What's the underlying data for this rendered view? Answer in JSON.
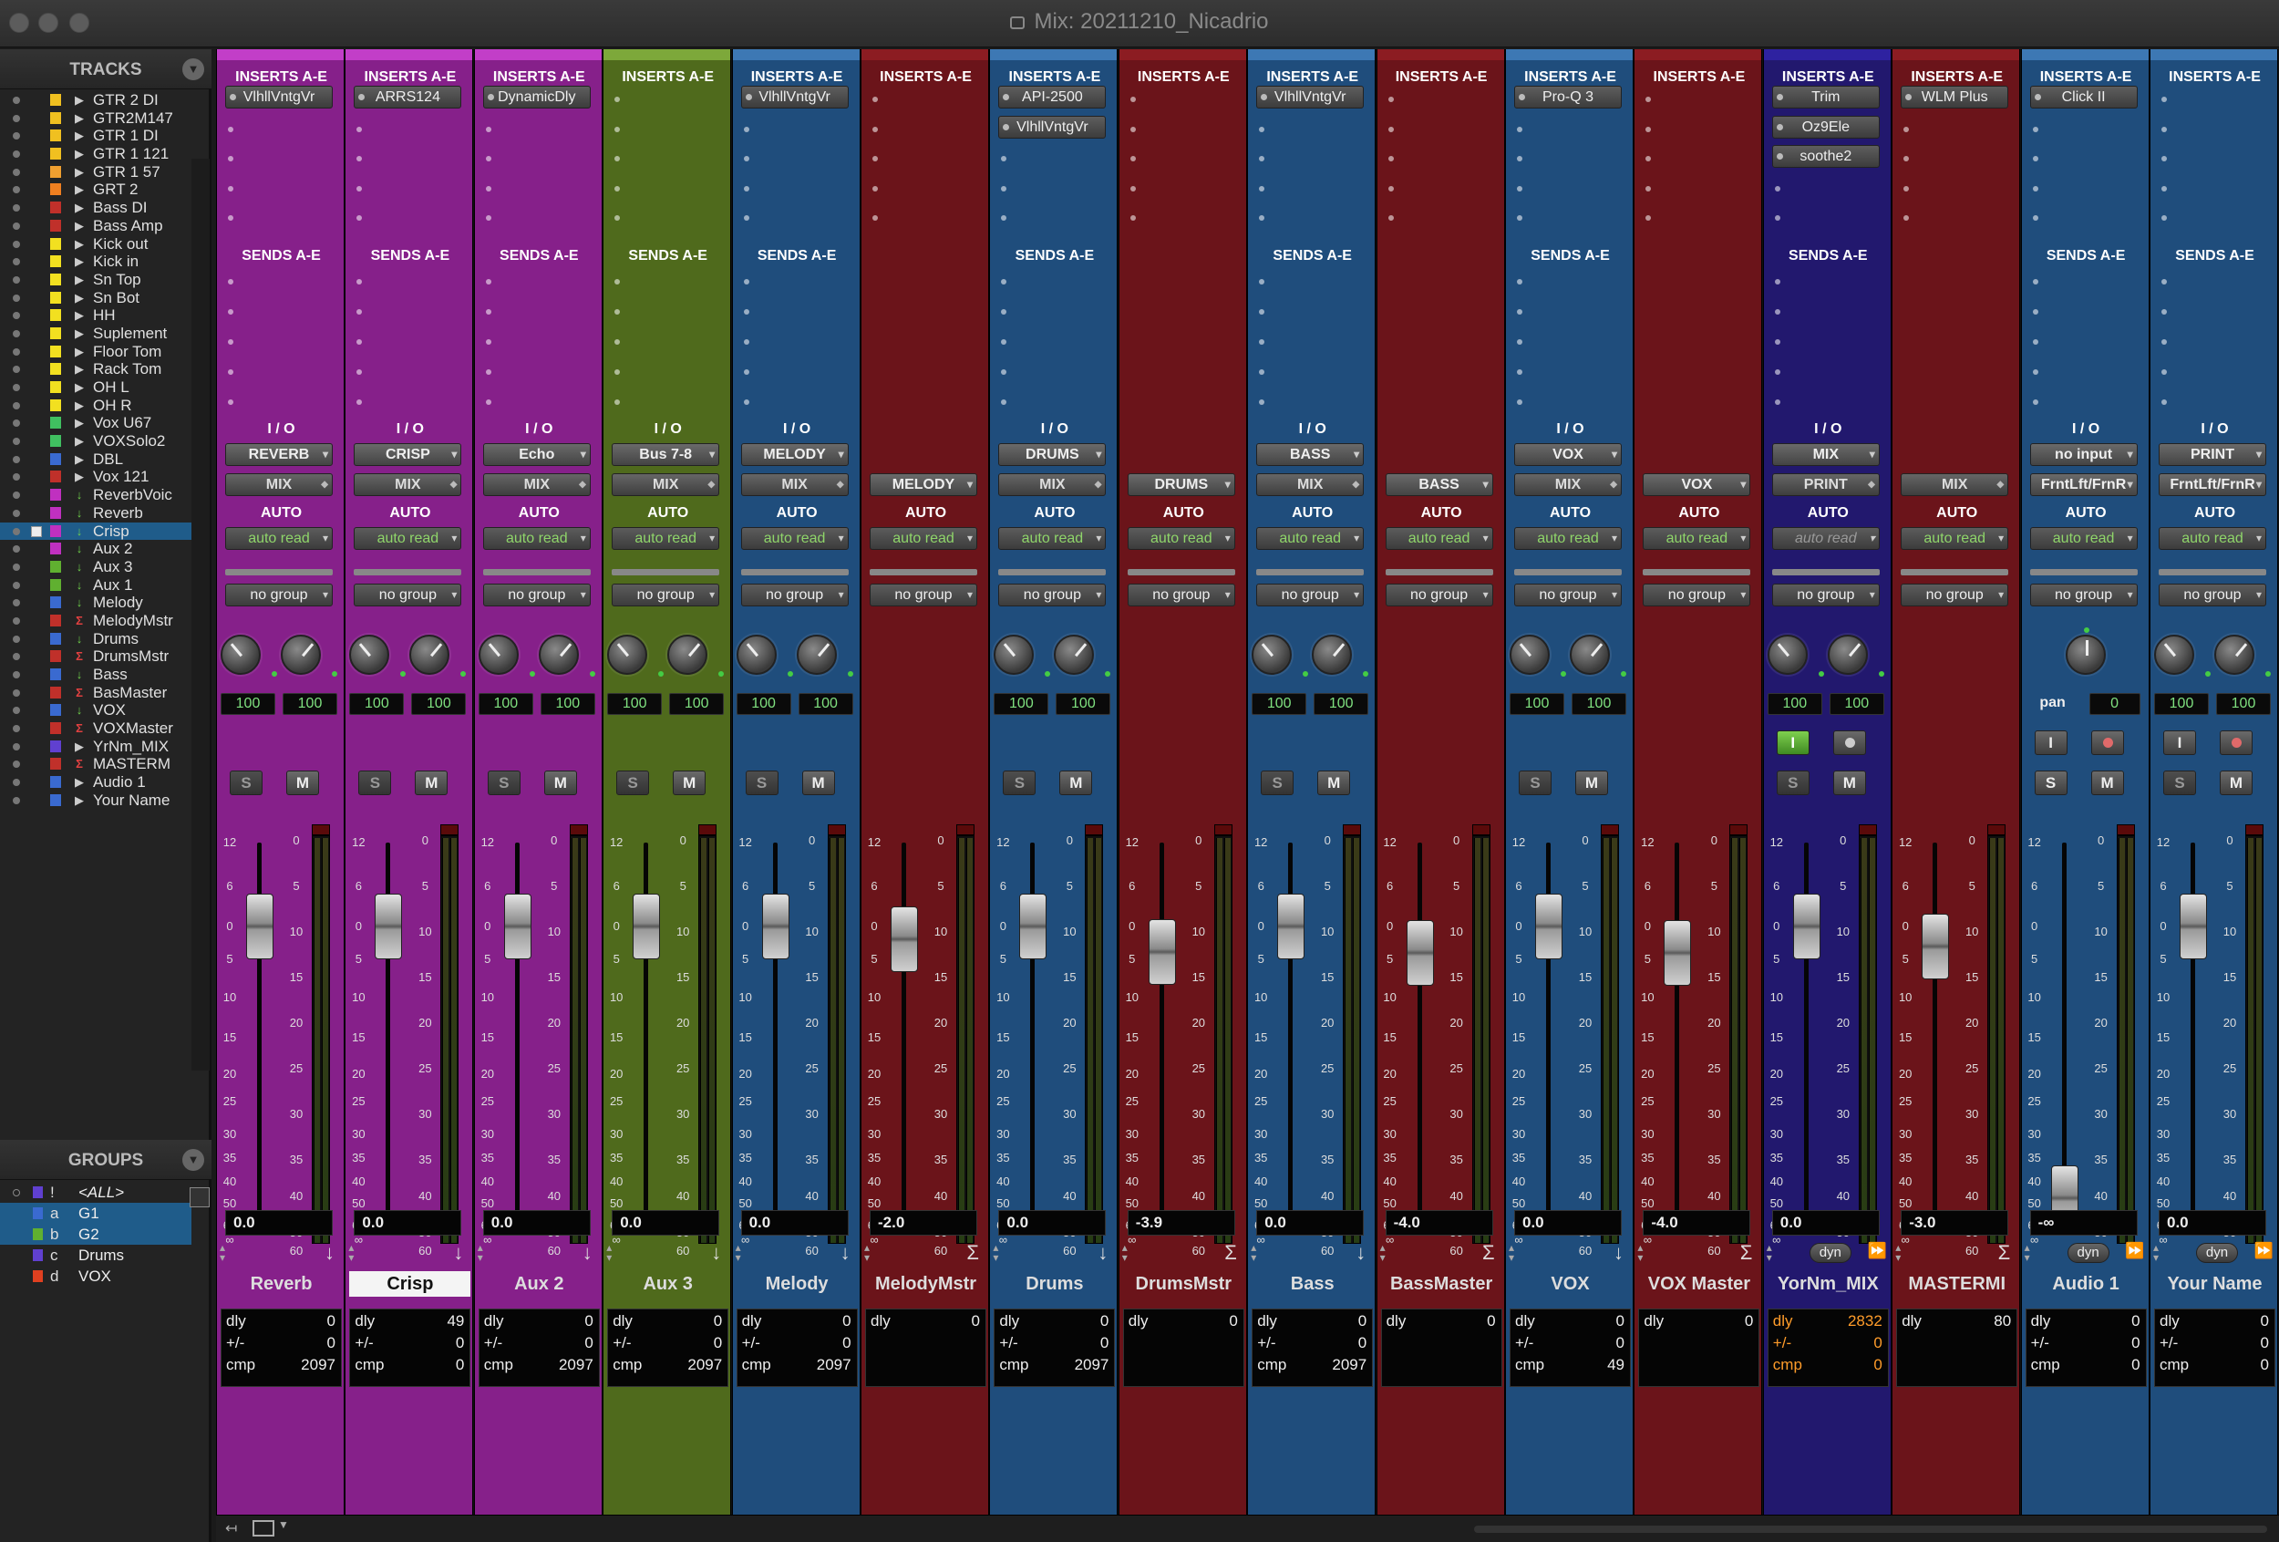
{
  "window": {
    "title": "Mix: 20211210_Nicadrio"
  },
  "tracks_panel": {
    "title": "TRACKS",
    "menu_icon": "chevron-down-icon"
  },
  "groups_panel": {
    "title": "GROUPS",
    "menu_icon": "chevron-down-icon"
  },
  "tracks": [
    {
      "name": "GTR 2 DI",
      "color": "#f0c020",
      "type": "audio"
    },
    {
      "name": "GTR2M147",
      "color": "#f0c020",
      "type": "audio"
    },
    {
      "name": "GTR 1 DI",
      "color": "#f0c020",
      "type": "audio"
    },
    {
      "name": "GTR 1 121",
      "color": "#f0c020",
      "type": "audio"
    },
    {
      "name": "GTR 1 57",
      "color": "#f0a030",
      "type": "audio"
    },
    {
      "name": "GRT 2",
      "color": "#f08020",
      "type": "audio"
    },
    {
      "name": "Bass DI",
      "color": "#c0302a",
      "type": "audio"
    },
    {
      "name": "Bass Amp",
      "color": "#c0302a",
      "type": "audio"
    },
    {
      "name": "Kick out",
      "color": "#f2e020",
      "type": "audio"
    },
    {
      "name": "Kick in",
      "color": "#f2e020",
      "type": "audio"
    },
    {
      "name": "Sn Top",
      "color": "#f2e020",
      "type": "audio"
    },
    {
      "name": "Sn Bot",
      "color": "#f2e020",
      "type": "audio"
    },
    {
      "name": "HH",
      "color": "#f2e020",
      "type": "audio"
    },
    {
      "name": "Suplement",
      "color": "#f2e020",
      "type": "audio"
    },
    {
      "name": "Floor Tom",
      "color": "#f2e020",
      "type": "audio"
    },
    {
      "name": "Rack Tom",
      "color": "#f2e020",
      "type": "audio"
    },
    {
      "name": "OH L",
      "color": "#f2e020",
      "type": "audio"
    },
    {
      "name": "OH R",
      "color": "#f2e020",
      "type": "audio"
    },
    {
      "name": "Vox U67",
      "color": "#40c060",
      "type": "audio"
    },
    {
      "name": "VOXSolo2",
      "color": "#40c060",
      "type": "audio"
    },
    {
      "name": "DBL",
      "color": "#3a6ad0",
      "type": "audio"
    },
    {
      "name": "Vox 121",
      "color": "#c0302a",
      "type": "audio"
    },
    {
      "name": "ReverbVoic",
      "color": "#c030c0",
      "type": "aux"
    },
    {
      "name": "Reverb",
      "color": "#c030c0",
      "type": "aux"
    },
    {
      "name": "Crisp",
      "color": "#c030c0",
      "type": "aux",
      "selected": true
    },
    {
      "name": "Aux 2",
      "color": "#c030c0",
      "type": "aux"
    },
    {
      "name": "Aux 3",
      "color": "#60b030",
      "type": "aux"
    },
    {
      "name": "Aux 1",
      "color": "#60b030",
      "type": "aux"
    },
    {
      "name": "Melody",
      "color": "#3a6ad0",
      "type": "aux"
    },
    {
      "name": "MelodyMstr",
      "color": "#c0302a",
      "type": "vca"
    },
    {
      "name": "Drums",
      "color": "#3a6ad0",
      "type": "aux"
    },
    {
      "name": "DrumsMstr",
      "color": "#c0302a",
      "type": "vca"
    },
    {
      "name": "Bass",
      "color": "#3a6ad0",
      "type": "aux"
    },
    {
      "name": "BasMaster",
      "color": "#c0302a",
      "type": "vca"
    },
    {
      "name": "VOX",
      "color": "#3a6ad0",
      "type": "aux"
    },
    {
      "name": "VOXMaster",
      "color": "#c0302a",
      "type": "vca"
    },
    {
      "name": "YrNm_MIX",
      "color": "#6040d0",
      "type": "audio"
    },
    {
      "name": "MASTERM",
      "color": "#c0302a",
      "type": "vca"
    },
    {
      "name": "Audio 1",
      "color": "#3a6ad0",
      "type": "audio"
    },
    {
      "name": "Your Name",
      "color": "#3a6ad0",
      "type": "audio"
    }
  ],
  "groups": [
    {
      "letter": "!",
      "name": "<ALL>",
      "color": "#6040d0",
      "all": true
    },
    {
      "letter": "a",
      "name": "G1",
      "color": "#3a6ad0",
      "selected": true
    },
    {
      "letter": "b",
      "name": "G2",
      "color": "#60b030",
      "selected": true
    },
    {
      "letter": "c",
      "name": "Drums",
      "color": "#6040d0"
    },
    {
      "letter": "d",
      "name": "VOX",
      "color": "#e04020"
    }
  ],
  "labels": {
    "inserts": "INSERTS A-E",
    "sends": "SENDS A-E",
    "io": "I / O",
    "auto": "AUTO",
    "dyn": "dyn",
    "solo": "S",
    "mute": "M",
    "input": "I",
    "dly": "dly",
    "pm": "+/-",
    "cmp": "cmp"
  },
  "fader_scale": [
    "12",
    "6",
    "0",
    "5",
    "10",
    "15",
    "20",
    "25",
    "30",
    "35",
    "40",
    "50",
    "60",
    "∞"
  ],
  "meter_scale": [
    "0",
    "5",
    "10",
    "15",
    "20",
    "25",
    "30",
    "35",
    "40",
    "50",
    "60"
  ],
  "strips": [
    {
      "name": "Reverb",
      "color": "#86208a",
      "accent": "#c23ec8",
      "inserts": [
        "VlhllVntgVr"
      ],
      "show_sends": true,
      "input": "REVERB",
      "output": "MIX",
      "out_caret": true,
      "auto": "auto read",
      "group": "no group",
      "pan": [
        "100",
        "100"
      ],
      "sm": true,
      "volume": "0.0",
      "fader_db": 0,
      "footer": "arrow",
      "dly": "0",
      "pm": "0",
      "cmp": "2097"
    },
    {
      "name": "Crisp",
      "color": "#86208a",
      "accent": "#c23ec8",
      "inserts": [
        "ARRS124"
      ],
      "show_sends": true,
      "input": "CRISP",
      "output": "MIX",
      "out_caret": true,
      "auto": "auto read",
      "group": "no group",
      "pan": [
        "100",
        "100"
      ],
      "sm": true,
      "volume": "0.0",
      "fader_db": 0,
      "footer": "arrow",
      "name_highlight": true,
      "dly": "49",
      "pm": "0",
      "cmp": "0"
    },
    {
      "name": "Aux 2",
      "color": "#86208a",
      "accent": "#c23ec8",
      "inserts": [
        "DynamicDly"
      ],
      "show_sends": true,
      "input": "Echo",
      "output": "MIX",
      "out_caret": true,
      "auto": "auto read",
      "group": "no group",
      "pan": [
        "100",
        "100"
      ],
      "sm": true,
      "volume": "0.0",
      "fader_db": 0,
      "footer": "arrow",
      "dly": "0",
      "pm": "0",
      "cmp": "2097"
    },
    {
      "name": "Aux 3",
      "color": "#4f6a1c",
      "accent": "#7da83a",
      "inserts": [],
      "show_sends": true,
      "input": "Bus 7-8",
      "output": "MIX",
      "out_caret": true,
      "auto": "auto read",
      "group": "no group",
      "pan": [
        "100",
        "100"
      ],
      "sm": true,
      "volume": "0.0",
      "fader_db": 0,
      "footer": "arrow",
      "dly": "0",
      "pm": "0",
      "cmp": "2097"
    },
    {
      "name": "Melody",
      "color": "#1f4d7c",
      "accent": "#3d78b4",
      "inserts": [
        "VlhllVntgVr"
      ],
      "show_sends": true,
      "input": "MELODY",
      "output": "MIX",
      "out_caret": true,
      "auto": "auto read",
      "group": "no group",
      "pan": [
        "100",
        "100"
      ],
      "sm": true,
      "volume": "0.0",
      "fader_db": 0,
      "footer": "arrow",
      "dly": "0",
      "pm": "0",
      "cmp": "2097"
    },
    {
      "name": "MelodyMstr",
      "color": "#6b141a",
      "accent": "#8c1c22",
      "inserts": [],
      "show_sends": false,
      "output": "MELODY",
      "out_caret": false,
      "auto": "auto read",
      "group": "no group",
      "vca": true,
      "volume": "-2.0",
      "fader_db": -2,
      "footer": "sigma",
      "dly": "0"
    },
    {
      "name": "Drums",
      "color": "#1f4d7c",
      "accent": "#3d78b4",
      "inserts": [
        "API-2500",
        "VlhllVntgVr"
      ],
      "show_sends": true,
      "input": "DRUMS",
      "output": "MIX",
      "out_caret": true,
      "auto": "auto read",
      "group": "no group",
      "pan": [
        "100",
        "100"
      ],
      "sm": true,
      "volume": "0.0",
      "fader_db": 0,
      "footer": "arrow",
      "dly": "0",
      "pm": "0",
      "cmp": "2097"
    },
    {
      "name": "DrumsMstr",
      "color": "#6b141a",
      "accent": "#8c1c22",
      "inserts": [],
      "show_sends": false,
      "output": "DRUMS",
      "out_caret": false,
      "auto": "auto read",
      "group": "no group",
      "vca": true,
      "volume": "-3.9",
      "fader_db": -3.9,
      "footer": "sigma",
      "dly": "0"
    },
    {
      "name": "Bass",
      "color": "#1f4d7c",
      "accent": "#3d78b4",
      "inserts": [
        "VlhllVntgVr"
      ],
      "show_sends": true,
      "input": "BASS",
      "output": "MIX",
      "out_caret": true,
      "auto": "auto read",
      "group": "no group",
      "pan": [
        "100",
        "100"
      ],
      "sm": true,
      "volume": "0.0",
      "fader_db": 0,
      "footer": "arrow",
      "dly": "0",
      "pm": "0",
      "cmp": "2097"
    },
    {
      "name": "BassMaster",
      "color": "#6b141a",
      "accent": "#8c1c22",
      "inserts": [],
      "show_sends": false,
      "output": "BASS",
      "out_caret": false,
      "auto": "auto read",
      "group": "no group",
      "vca": true,
      "volume": "-4.0",
      "fader_db": -4,
      "footer": "sigma",
      "dly": "0"
    },
    {
      "name": "VOX",
      "color": "#1f4d7c",
      "accent": "#3d78b4",
      "inserts": [
        "Pro-Q 3"
      ],
      "show_sends": true,
      "input": "VOX",
      "output": "MIX",
      "out_caret": true,
      "auto": "auto read",
      "group": "no group",
      "pan": [
        "100",
        "100"
      ],
      "sm": true,
      "volume": "0.0",
      "fader_db": 0,
      "footer": "arrow",
      "dly": "0",
      "pm": "0",
      "cmp": "49"
    },
    {
      "name": "VOX Master",
      "color": "#6b141a",
      "accent": "#8c1c22",
      "inserts": [],
      "show_sends": false,
      "output": "VOX",
      "out_caret": false,
      "auto": "auto read",
      "group": "no group",
      "vca": true,
      "volume": "-4.0",
      "fader_db": -4,
      "footer": "sigma",
      "dly": "0"
    },
    {
      "name": "YorNm_MIX",
      "color": "#22186e",
      "accent": "#2e22a0",
      "inserts": [
        "Trim",
        "Oz9Ele",
        "soothe2"
      ],
      "show_sends": true,
      "input": "MIX",
      "output": "PRINT",
      "out_caret": true,
      "auto": "auto read",
      "auto_dim": true,
      "group": "no group",
      "pan": [
        "100",
        "100"
      ],
      "input_btn": true,
      "input_on": true,
      "sm": true,
      "volume": "0.0",
      "fader_db": 0,
      "footer": "dyn",
      "dly": "2832",
      "pm": "0",
      "cmp": "0",
      "info_orange": true
    },
    {
      "name": "MASTERMI",
      "color": "#6b141a",
      "accent": "#8c1c22",
      "inserts": [
        "WLM Plus"
      ],
      "show_sends": false,
      "output": "MIX",
      "out_caret": true,
      "auto": "auto read",
      "group": "no group",
      "vca": true,
      "volume": "-3.0",
      "fader_db": -3,
      "footer": "sigma",
      "dly": "80"
    },
    {
      "name": "Audio 1",
      "color": "#1f4d7c",
      "accent": "#3d78b4",
      "inserts": [
        "Click II"
      ],
      "show_sends": true,
      "input": "no input",
      "output": "FrntLft/FrnR",
      "out_caret": false,
      "auto": "auto read",
      "group": "no group",
      "mono": true,
      "pan_label": "pan",
      "pan_value": "0",
      "input_btn": true,
      "rec_red": true,
      "sm": true,
      "sm_bright": true,
      "volume": "-∞",
      "fader_db": -200,
      "footer": "dyn",
      "dly": "0",
      "pm": "0",
      "cmp": "0"
    },
    {
      "name": "Your Name",
      "color": "#1f4d7c",
      "accent": "#3d78b4",
      "inserts": [],
      "show_sends": true,
      "input": "PRINT",
      "output": "FrntLft/FrnR",
      "out_caret": false,
      "auto": "auto read",
      "group": "no group",
      "pan": [
        "100",
        "100"
      ],
      "input_btn": true,
      "rec_red": true,
      "sm": true,
      "volume": "0.0",
      "fader_db": 0,
      "footer": "dyn",
      "dly": "0",
      "pm": "0",
      "cmp": "0"
    }
  ]
}
